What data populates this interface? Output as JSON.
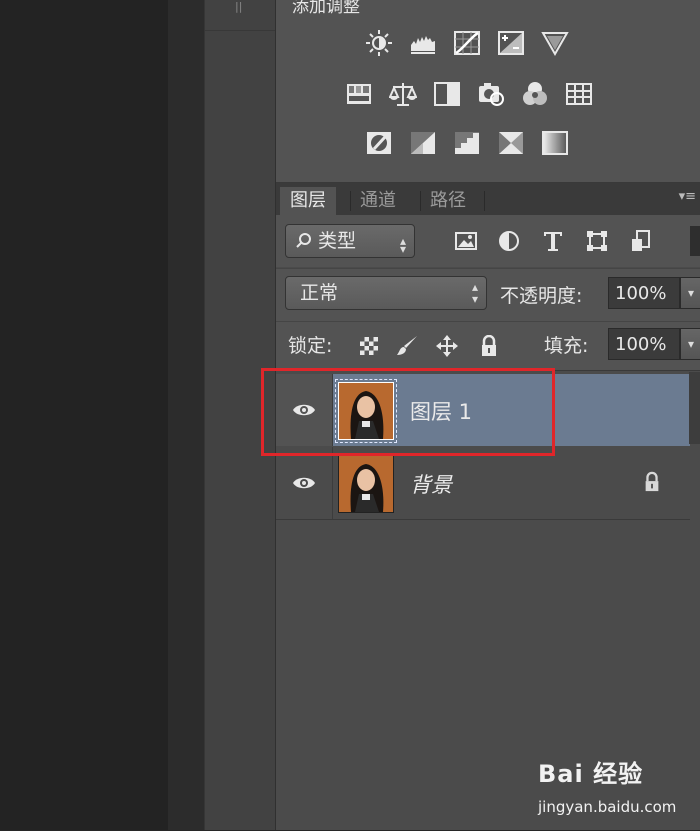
{
  "adjustments": {
    "title": "添加调整",
    "rows": [
      [
        "brightness-contrast-icon",
        "levels-icon",
        "curves-icon",
        "exposure-icon",
        "vibrance-icon"
      ],
      [
        "hue-saturation-icon",
        "color-balance-icon",
        "black-white-icon",
        "photo-filter-icon",
        "channel-mixer-icon",
        "color-lookup-icon"
      ],
      [
        "invert-icon",
        "posterize-icon",
        "threshold-icon",
        "selective-color-icon",
        "gradient-map-icon"
      ]
    ]
  },
  "tabs": [
    {
      "label": "图层",
      "active": true
    },
    {
      "label": "通道",
      "active": false
    },
    {
      "label": "路径",
      "active": false
    }
  ],
  "filter": {
    "kind_label": "类型",
    "icons": [
      "pixel-layer-filter-icon",
      "adjustment-layer-filter-icon",
      "type-layer-filter-icon",
      "shape-layer-filter-icon",
      "smart-object-filter-icon"
    ]
  },
  "blend": {
    "mode": "正常",
    "opacity_label": "不透明度:",
    "opacity_value": "100%"
  },
  "lock": {
    "label": "锁定:",
    "fill_label": "填充:",
    "fill_value": "100%"
  },
  "layers": [
    {
      "name": "图层 1",
      "selected": true,
      "locked": false,
      "visible": true
    },
    {
      "name": "背景",
      "selected": false,
      "locked": true,
      "visible": true
    }
  ],
  "watermark": {
    "logo": "Bai 经验",
    "url": "jingyan.baidu.com"
  },
  "colors": {
    "panel_bg": "#535353",
    "selected_layer": "#6b7b91",
    "highlight_box": "#e0262a"
  }
}
